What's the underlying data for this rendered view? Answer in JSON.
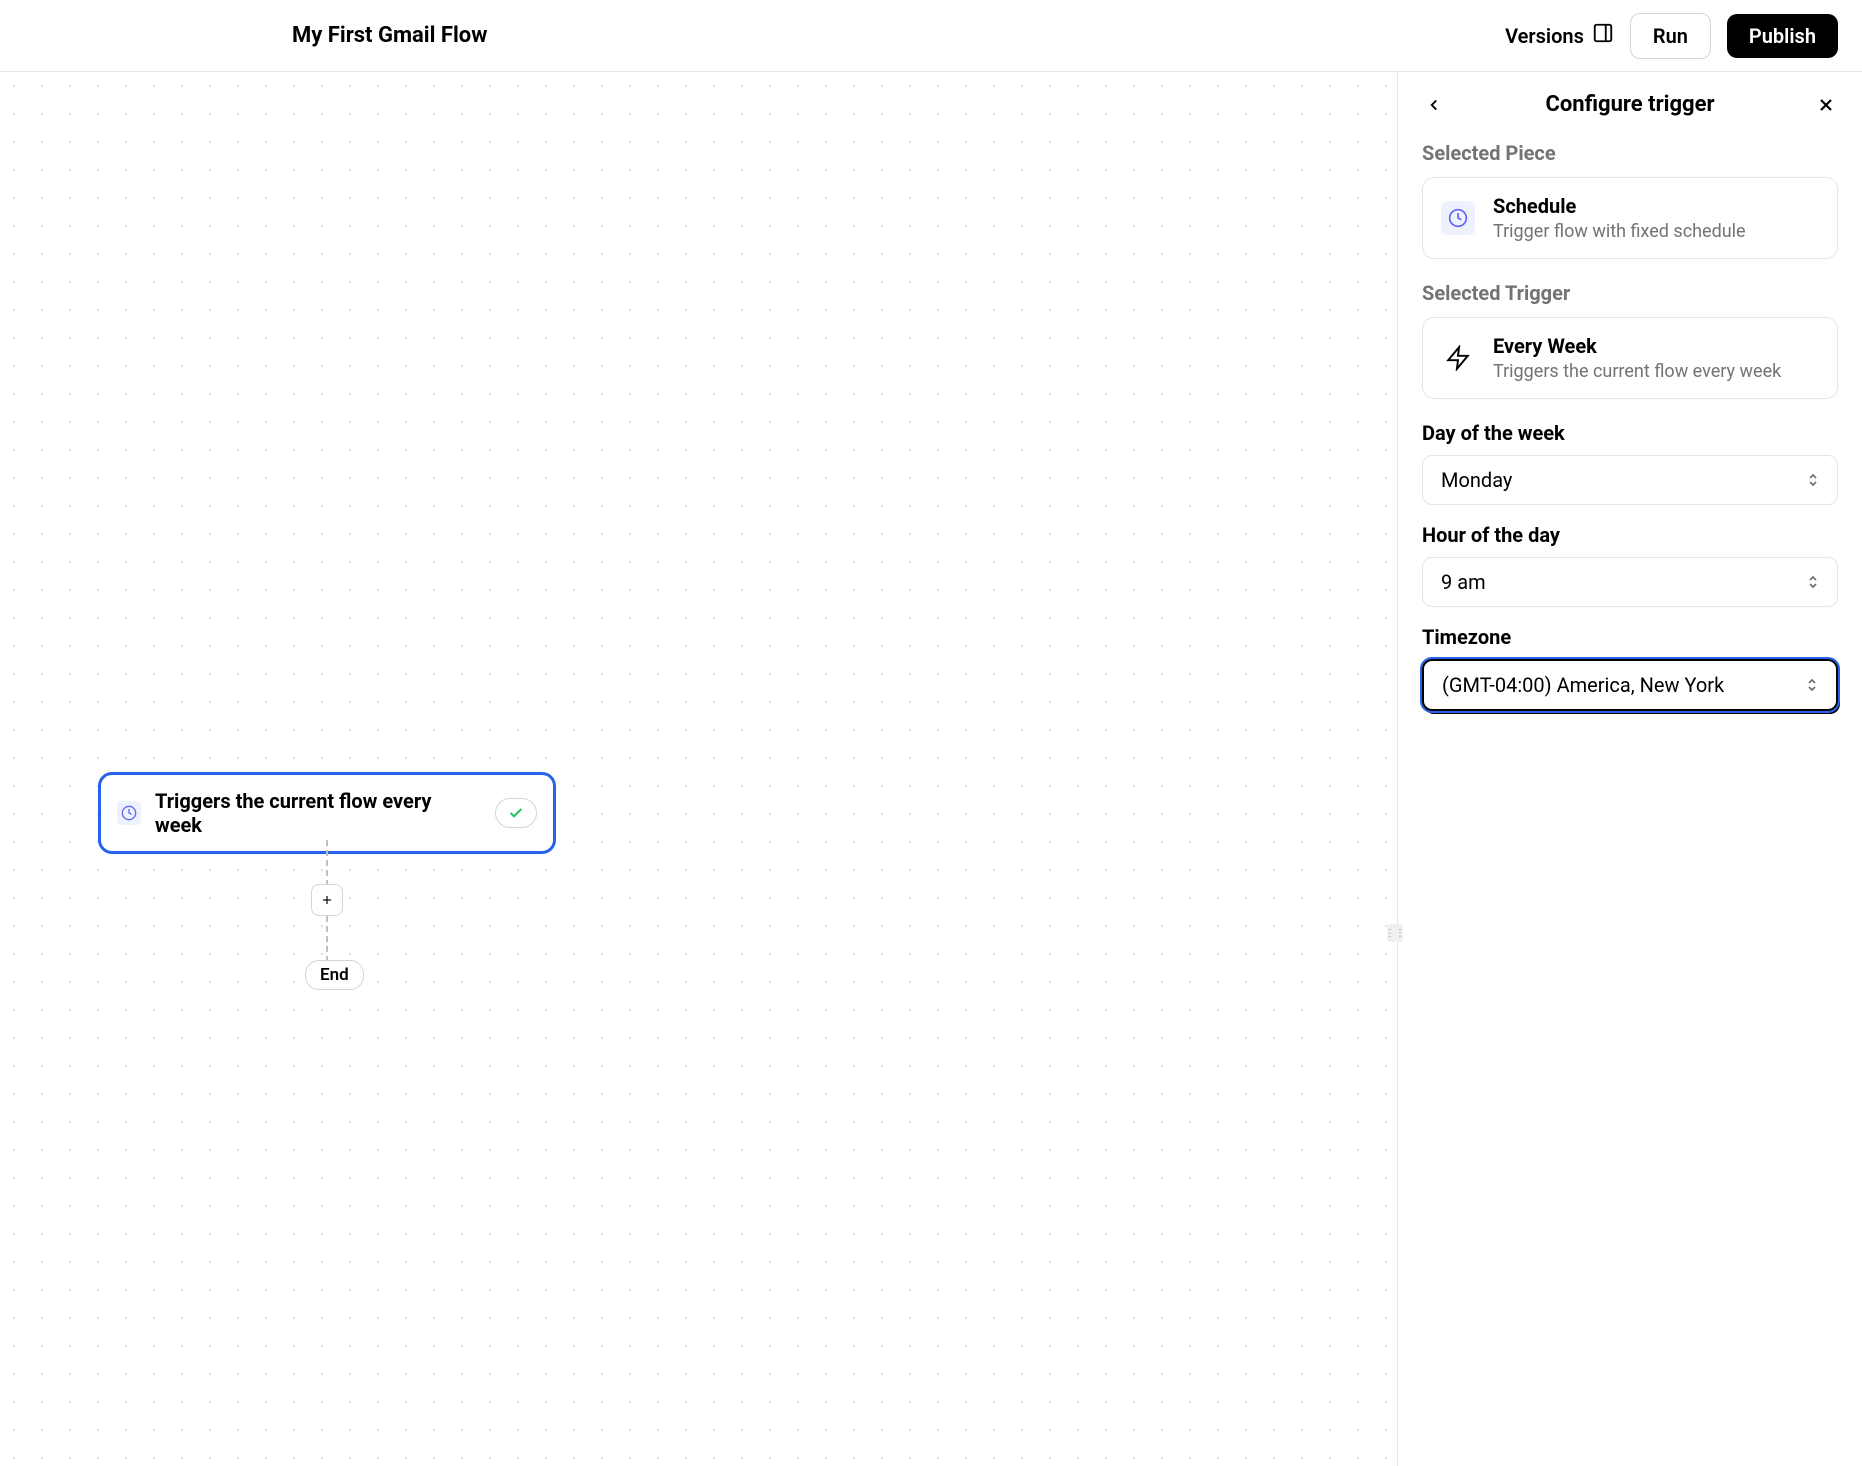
{
  "header": {
    "title": "My First Gmail Flow",
    "versions": "Versions",
    "run": "Run",
    "publish": "Publish"
  },
  "canvas": {
    "trigger_node_text": "Triggers the current flow every week",
    "end_label": "End"
  },
  "sidebar": {
    "title": "Configure trigger",
    "selected_piece_label": "Selected Piece",
    "piece": {
      "name": "Schedule",
      "desc": "Trigger flow with fixed schedule"
    },
    "selected_trigger_label": "Selected Trigger",
    "trigger": {
      "name": "Every Week",
      "desc": "Triggers the current flow every week"
    },
    "day_label": "Day of the week",
    "day_value": "Monday",
    "hour_label": "Hour of the day",
    "hour_value": "9 am",
    "tz_label": "Timezone",
    "tz_value": "(GMT-04:00) America, New York"
  }
}
